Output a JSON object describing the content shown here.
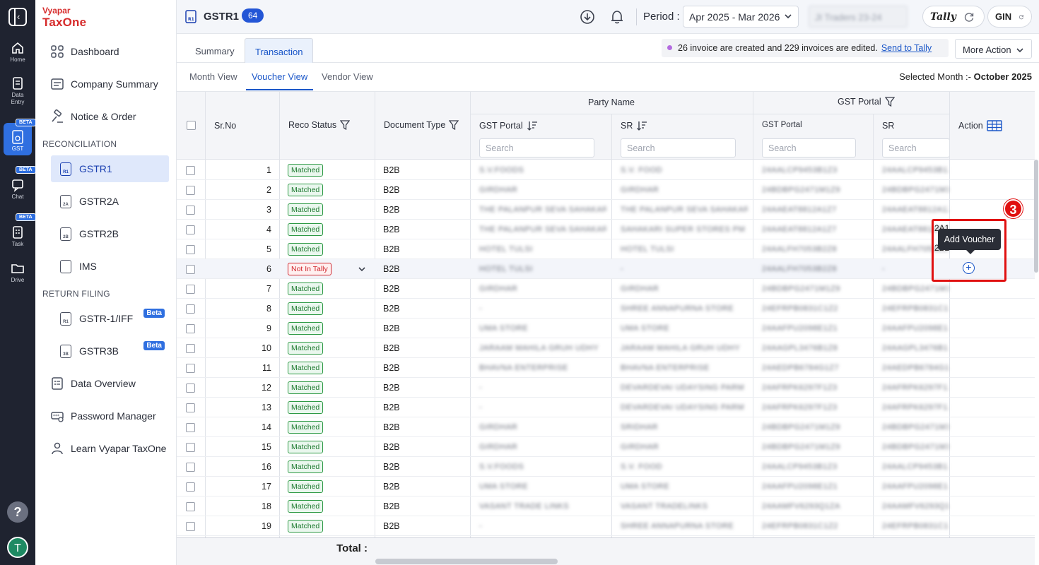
{
  "rail": {
    "items": [
      {
        "label": "Home",
        "icon": "home-icon"
      },
      {
        "label": "Data",
        "label2": "Entry",
        "icon": "data-entry-icon"
      },
      {
        "label": "GST",
        "icon": "gst-icon",
        "badge": "BETA"
      },
      {
        "label": "Chat",
        "icon": "chat-icon",
        "badge": "BETA"
      },
      {
        "label": "Task",
        "icon": "task-icon",
        "badge": "BETA"
      },
      {
        "label": "Drive",
        "icon": "drive-icon"
      }
    ],
    "help": "?",
    "avatar": "T"
  },
  "brand": {
    "top": "Vyapar",
    "main": "TaxOne"
  },
  "sidebar": {
    "dashboard": "Dashboard",
    "company_summary": "Company Summary",
    "notice_order": "Notice & Order",
    "section_reconciliation": "RECONCILIATION",
    "gstr1": "GSTR1",
    "gstr2a": "GSTR2A",
    "gstr2b": "GSTR2B",
    "ims": "IMS",
    "section_return": "RETURN FILING",
    "gstr1iff": "GSTR-1/IFF",
    "gstr3b": "GSTR3B",
    "beta": "Beta",
    "data_overview": "Data Overview",
    "password_manager": "Password Manager",
    "learn": "Learn Vyapar TaxOne",
    "doc_codes": {
      "gstr1": "R1",
      "gstr2a": "2A",
      "gstr2b": "2B",
      "ims": "",
      "gstr1iff": "R1",
      "gstr3b": "3B"
    }
  },
  "header": {
    "title": "GSTR1",
    "count": "64",
    "period_label": "Period :",
    "period_value": "Apr 2025 - Mar 2026",
    "company_value": "JI Traders 23-24",
    "tally_label": "Tally",
    "gin_label": "GIN"
  },
  "tabs": {
    "summary": "Summary",
    "transaction": "Transaction"
  },
  "notice": {
    "text": "26 invoice are created and 229 invoices are edited.",
    "link": "Send to Tally"
  },
  "more_action": "More Action",
  "subtabs": {
    "month": "Month View",
    "voucher": "Voucher View",
    "vendor": "Vendor View"
  },
  "selected_month": {
    "label": "Selected Month :-",
    "value": "October 2025"
  },
  "table": {
    "headers": {
      "sr_no": "Sr.No",
      "reco_status": "Reco Status",
      "document_type": "Document Type",
      "party_name": "Party Name",
      "gst_portal_group": "GST Portal",
      "party_gst_portal": "GST Portal",
      "party_sr": "SR",
      "gstin_gst_portal": "GST Portal",
      "gstin_sr": "SR",
      "action": "Action"
    },
    "search_placeholder": "Search",
    "total_label": "Total :",
    "rows": [
      {
        "sr": "1",
        "status": "Matched",
        "doc": "B2B",
        "p1": "S.V.FOODS",
        "p2": "S.V. FOOD",
        "g1": "24AALCP9453B1Z3",
        "g2": "24AALCP9453B1Z3"
      },
      {
        "sr": "2",
        "status": "Matched",
        "doc": "B2B",
        "p1": "GIRDHAR",
        "p2": "GIRDHAR",
        "g1": "24BDBPG2471M1Z9",
        "g2": "24BDBPG2471M1Z9"
      },
      {
        "sr": "3",
        "status": "Matched",
        "doc": "B2B",
        "p1": "THE PALANPUR SEVA SAHAKARI",
        "p2": "THE PALANPUR SEVA SAHAKARI",
        "g1": "24AAEAT8812A1Z7",
        "g2": "24AAEAT8812A1Z7"
      },
      {
        "sr": "4",
        "status": "Matched",
        "doc": "B2B",
        "p1": "THE PALANPUR SEVA SAHAKARI",
        "p2": "SAHAKARI SUPER STORES PM",
        "g1": "24AAEAT8812A1Z7",
        "g2": "24AAEAT8812A1Z7"
      },
      {
        "sr": "5",
        "status": "Matched",
        "doc": "B2B",
        "p1": "HOTEL TULSI",
        "p2": "HOTEL TULSI",
        "g1": "24AALFH7053B2Z8",
        "g2": "24AALFH7053B2Z8"
      },
      {
        "sr": "6",
        "status": "Not In Tally",
        "doc": "B2B",
        "p1": "HOTEL TULSI",
        "p2": "-",
        "g1": "24AALFH7053B2Z8",
        "g2": "-"
      },
      {
        "sr": "7",
        "status": "Matched",
        "doc": "B2B",
        "p1": "GIRDHAR",
        "p2": "GIRDHAR",
        "g1": "24BDBPG2471M1Z9",
        "g2": "24BDBPG2471M1Z9"
      },
      {
        "sr": "8",
        "status": "Matched",
        "doc": "B2B",
        "p1": "-",
        "p2": "SHREE ANNAPURNA STORE",
        "g1": "24EFRPB0831C1Z2",
        "g2": "24EFRPB0831C1Z2"
      },
      {
        "sr": "9",
        "status": "Matched",
        "doc": "B2B",
        "p1": "UMA STORE",
        "p2": "UMA STORE",
        "g1": "24AAFPU2098E1Z1",
        "g2": "24AAFPU2098E1Z1"
      },
      {
        "sr": "10",
        "status": "Matched",
        "doc": "B2B",
        "p1": "JARAAM MAHILA GRUH UDHY",
        "p2": "JARAAM MAHILA GRUH UDHY",
        "g1": "24AAGPL3476B1Z8",
        "g2": "24AAGPL3476B1Z8"
      },
      {
        "sr": "11",
        "status": "Matched",
        "doc": "B2B",
        "p1": "BHAVNA ENTERPRISE",
        "p2": "BHAVNA ENTERPRISE",
        "g1": "24AEDPB6784G1Z7",
        "g2": "24AEDPB6784G1Z7"
      },
      {
        "sr": "12",
        "status": "Matched",
        "doc": "B2B",
        "p1": "-",
        "p2": "DEVARDEVAI UDAYSING PARM",
        "g1": "24AFRPK6297F1Z3",
        "g2": "24AFRPK6297F1Z3"
      },
      {
        "sr": "13",
        "status": "Matched",
        "doc": "B2B",
        "p1": "-",
        "p2": "DEVARDEVAI UDAYSING PARM",
        "g1": "24AFRPK6297F1Z3",
        "g2": "24AFRPK6297F1Z3"
      },
      {
        "sr": "14",
        "status": "Matched",
        "doc": "B2B",
        "p1": "GIRDHAR",
        "p2": "SRIDHAR",
        "g1": "24BDBPG2471M1Z9",
        "g2": "24BDBPG2471M1Z9"
      },
      {
        "sr": "15",
        "status": "Matched",
        "doc": "B2B",
        "p1": "GIRDHAR",
        "p2": "GIRDHAR",
        "g1": "24BDBPG2471M1Z9",
        "g2": "24BDBPG2471M1Z9"
      },
      {
        "sr": "16",
        "status": "Matched",
        "doc": "B2B",
        "p1": "S.V.FOODS",
        "p2": "S.V. FOOD",
        "g1": "24AALCP9453B1Z3",
        "g2": "24AALCP9453B1Z3"
      },
      {
        "sr": "17",
        "status": "Matched",
        "doc": "B2B",
        "p1": "UMA STORE",
        "p2": "UMA STORE",
        "g1": "24AAFPU2098E1Z1",
        "g2": "24AAFPU2098E1Z1"
      },
      {
        "sr": "18",
        "status": "Matched",
        "doc": "B2B",
        "p1": "VASANT TRADE LINKS",
        "p2": "VASANT TRADELINKS",
        "g1": "24AAMFV6293Q1ZA",
        "g2": "24AAMFV6293Q1ZA"
      },
      {
        "sr": "19",
        "status": "Matched",
        "doc": "B2B",
        "p1": "-",
        "p2": "SHREE ANNAPURNA STORE",
        "g1": "24EFRPB0831C1Z2",
        "g2": "24EFRPB0831C1Z2"
      }
    ]
  },
  "tooltip": {
    "text": "Add Voucher"
  },
  "step_badge": "3",
  "peek": {
    "row4": "2A1",
    "row5": "2B2"
  },
  "colors": {
    "brand_red": "#d62b2b",
    "accent_blue": "#2456d6",
    "matched_green": "#1e7a30",
    "not_in_tally_red": "#d0262d",
    "highlight_red": "#e01010"
  }
}
